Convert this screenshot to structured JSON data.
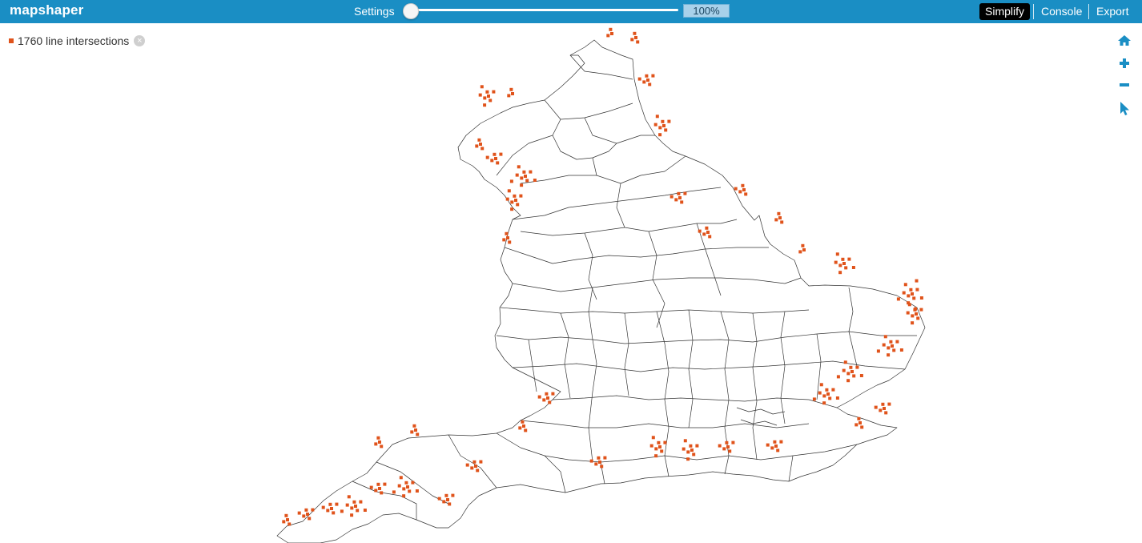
{
  "app": {
    "title": "mapshaper"
  },
  "topbar": {
    "settings_label": "Settings",
    "simplify_pct": "100%",
    "simplify_level": 1.0,
    "menu": {
      "simplify": "Simplify",
      "console": "Console",
      "export": "Export"
    }
  },
  "layer_info": {
    "label": "1760 line intersections",
    "marker_color": "#e0531b"
  },
  "tools": [
    "home-icon",
    "zoom-in-icon",
    "zoom-out-icon",
    "pointer-icon"
  ],
  "colors": {
    "bar": "#1a8ec4",
    "accent": "#e0531b",
    "boundary": "#333333"
  }
}
